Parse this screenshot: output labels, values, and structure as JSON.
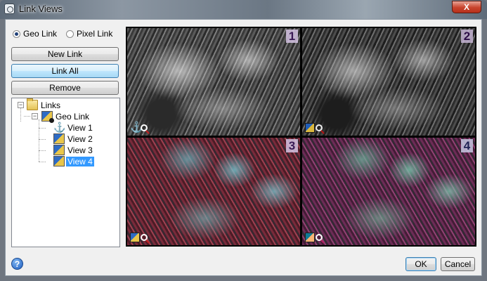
{
  "window": {
    "title": "Link Views",
    "close_label": "X"
  },
  "link_mode": {
    "options": [
      "Geo Link",
      "Pixel Link"
    ],
    "selected": "Geo Link"
  },
  "buttons": {
    "new_link": "New Link",
    "link_all": "Link All",
    "remove": "Remove"
  },
  "tree": {
    "root": {
      "label": "Links",
      "icon": "folder-icon",
      "expanded": true
    },
    "group": {
      "label": "Geo Link",
      "icon": "georeference-icon",
      "expanded": true
    },
    "views": [
      {
        "label": "View 1",
        "icon": "anchor-icon",
        "selected": false
      },
      {
        "label": "View 2",
        "icon": "view-icon",
        "selected": false
      },
      {
        "label": "View 3",
        "icon": "view-icon",
        "selected": false
      },
      {
        "label": "View 4",
        "icon": "view-icon",
        "selected": true
      }
    ]
  },
  "view_panels": [
    {
      "number": "1",
      "icons": [
        "anchor-icon",
        "magnifier-icon"
      ],
      "imagery": "grayscale aerial"
    },
    {
      "number": "2",
      "icons": [
        "georeference-icon",
        "magnifier-icon"
      ],
      "imagery": "grayscale aerial"
    },
    {
      "number": "3",
      "icons": [
        "georeference-icon",
        "magnifier-icon"
      ],
      "imagery": "color infrared aerial"
    },
    {
      "number": "4",
      "icons": [
        "georeference-icon",
        "magnifier-icon"
      ],
      "imagery": "color infrared aerial"
    }
  ],
  "footer": {
    "ok": "OK",
    "cancel": "Cancel",
    "help": "?"
  }
}
